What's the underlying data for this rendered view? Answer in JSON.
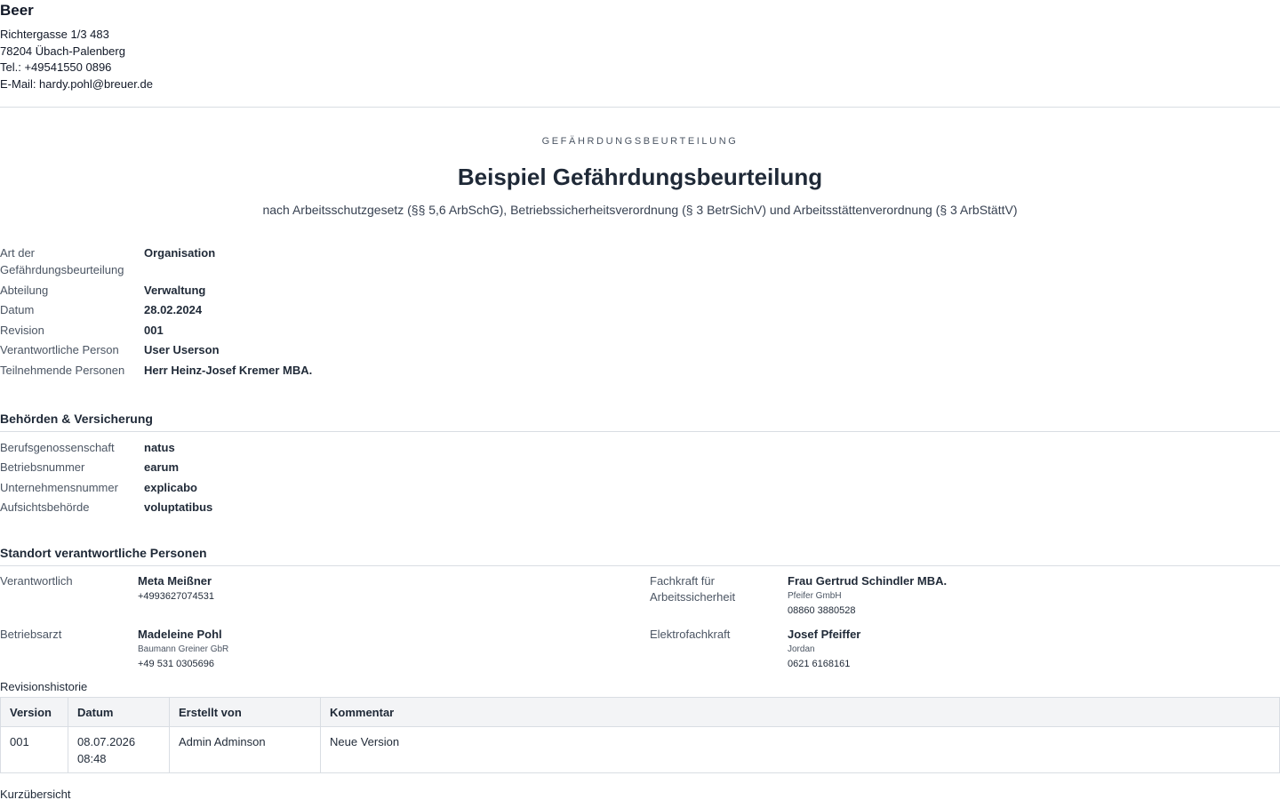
{
  "company": {
    "name": "Beer",
    "street": "Richtergasse 1/3 483",
    "city": "78204 Übach-Palenberg",
    "phone": "Tel.: +49541550 0896",
    "email": "E-Mail: hardy.pohl@breuer.de"
  },
  "header": {
    "eyebrow": "GEFÄHRDUNGSBEURTEILUNG",
    "title": "Beispiel Gefährdungsbeurteilung",
    "subtitle": "nach Arbeitsschutzgesetz (§§ 5,6 ArbSchG), Betriebssicherheitsverordnung (§ 3 BetrSichV) und Arbeitsstättenverordnung (§ 3 ArbStättV)"
  },
  "meta": [
    {
      "label": "Art der Gefährdungsbeurteilung",
      "value": "Organisation"
    },
    {
      "label": "Abteilung",
      "value": "Verwaltung"
    },
    {
      "label": "Datum",
      "value": "28.02.2024"
    },
    {
      "label": "Revision",
      "value": "001"
    },
    {
      "label": "Verantwortliche Person",
      "value": "User Userson"
    },
    {
      "label": "Teilnehmende Personen",
      "value": "Herr Heinz-Josef Kremer MBA."
    }
  ],
  "authorities": {
    "title": "Behörden & Versicherung",
    "rows": [
      {
        "label": "Berufsgenossenschaft",
        "value": "natus"
      },
      {
        "label": "Betriebsnummer",
        "value": "earum"
      },
      {
        "label": "Unternehmensnummer",
        "value": "explicabo"
      },
      {
        "label": "Aufsichtsbehörde",
        "value": "voluptatibus"
      }
    ]
  },
  "persons": {
    "title": "Standort verantwortliche Personen",
    "items": [
      {
        "role": "Verantwortlich",
        "name": "Meta Meißner",
        "company": "",
        "phone": "+4993627074531"
      },
      {
        "role": "Fachkraft für Arbeitssicherheit",
        "name": "Frau Gertrud Schindler MBA.",
        "company": "Pfeifer GmbH",
        "phone": "08860 3880528"
      },
      {
        "role": "Betriebsarzt",
        "name": "Madeleine Pohl",
        "company": "Baumann Greiner GbR",
        "phone": "+49 531 0305696"
      },
      {
        "role": "Elektrofachkraft",
        "name": "Josef Pfeiffer",
        "company": "Jordan",
        "phone": "0621 6168161"
      }
    ]
  },
  "revisions": {
    "caption": "Revisionshistorie",
    "headers": [
      "Version",
      "Datum",
      "Erstellt von",
      "Kommentar"
    ],
    "rows": [
      {
        "version": "001",
        "date": "08.07.2026",
        "time": "08:48",
        "author": "Admin Adminson",
        "comment": "Neue Version"
      }
    ]
  },
  "summary": {
    "caption": "Kurzübersicht"
  }
}
